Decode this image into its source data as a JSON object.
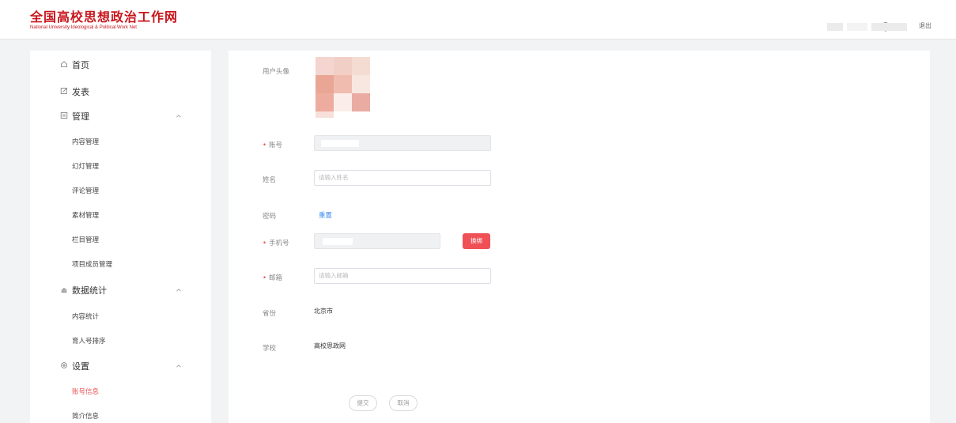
{
  "header": {
    "logo_cn": "全国高校思想政治工作网",
    "logo_en": "National University Ideological & Political Work Net",
    "logout_label": "退出"
  },
  "sidebar": {
    "items": [
      {
        "label": "首页",
        "icon": "home-icon"
      },
      {
        "label": "发表",
        "icon": "edit-icon"
      },
      {
        "label": "管理",
        "icon": "manage-icon",
        "children": [
          "内容管理",
          "幻灯管理",
          "评论管理",
          "素材管理",
          "栏目管理",
          "项目成员管理"
        ]
      },
      {
        "label": "数据统计",
        "icon": "chart-icon",
        "children": [
          "内容统计",
          "育人号排序"
        ]
      },
      {
        "label": "设置",
        "icon": "settings-icon",
        "children": [
          "账号信息",
          "简介信息"
        ]
      }
    ],
    "active": "账号信息"
  },
  "form": {
    "avatar_label": "用户头像",
    "account_label": "账号",
    "name_label": "姓名",
    "name_placeholder": "请输入姓名",
    "password_label": "密码",
    "reset_label": "重置",
    "phone_label": "手机号",
    "change_label": "换绑",
    "email_label": "邮箱",
    "email_placeholder": "请输入邮箱",
    "province_label": "省份",
    "province_value": "北京市",
    "school_label": "学校",
    "school_value": "高校思政网",
    "submit_label": "提交",
    "cancel_label": "取消"
  },
  "colors": {
    "brand_red": "#c8161d",
    "accent_red": "#ef5157",
    "link_blue": "#3b8cf0"
  }
}
